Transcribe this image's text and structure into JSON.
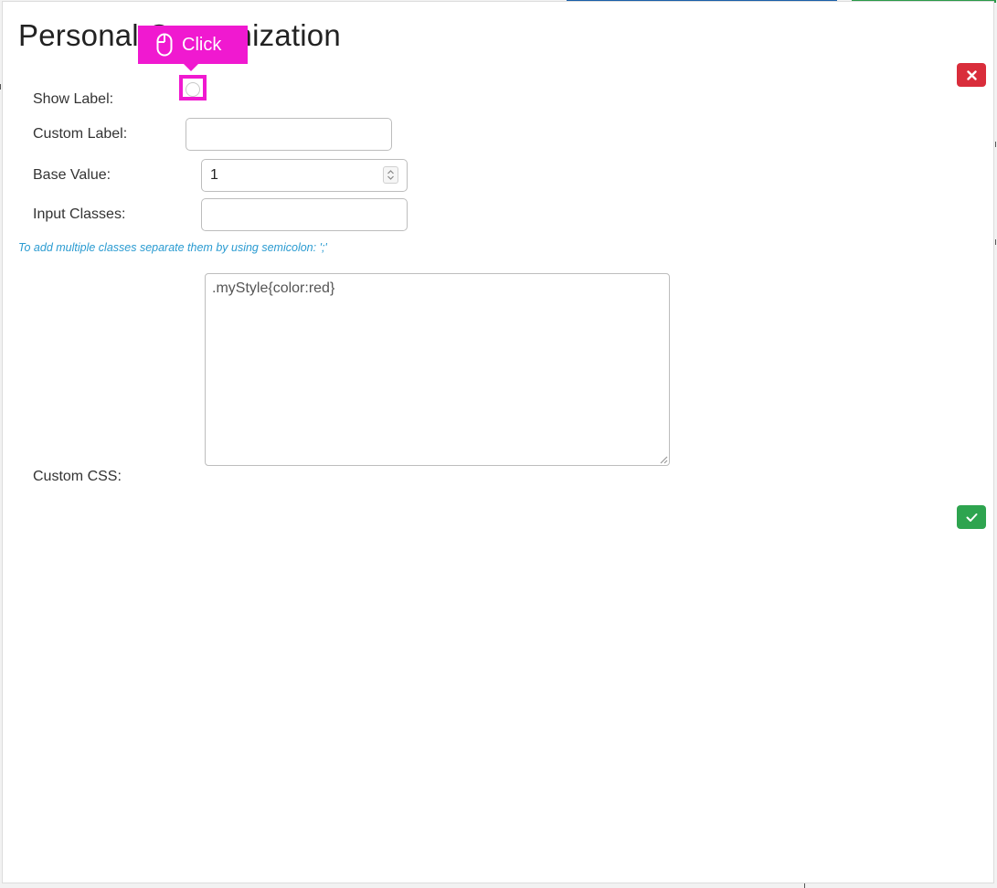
{
  "dialog": {
    "title": "Personal Customization"
  },
  "form": {
    "show_label": {
      "label": "Show Label:",
      "checked": false
    },
    "custom_label": {
      "label": "Custom Label:",
      "value": ""
    },
    "base_value": {
      "label": "Base Value:",
      "value": "1"
    },
    "input_classes": {
      "label": "Input Classes:",
      "value": "",
      "hint": "To add multiple classes separate them by using semicolon: ';'"
    },
    "custom_css": {
      "label": "Custom CSS:",
      "value": ".myStyle{color:red}"
    }
  },
  "overlay": {
    "click_tip": "Click",
    "icon": "mouse-icon"
  },
  "colors": {
    "close_button": "#d92d3b",
    "confirm_button": "#2ea44f",
    "hint_text": "#2a9bd1",
    "overlay": "#f019d0"
  }
}
